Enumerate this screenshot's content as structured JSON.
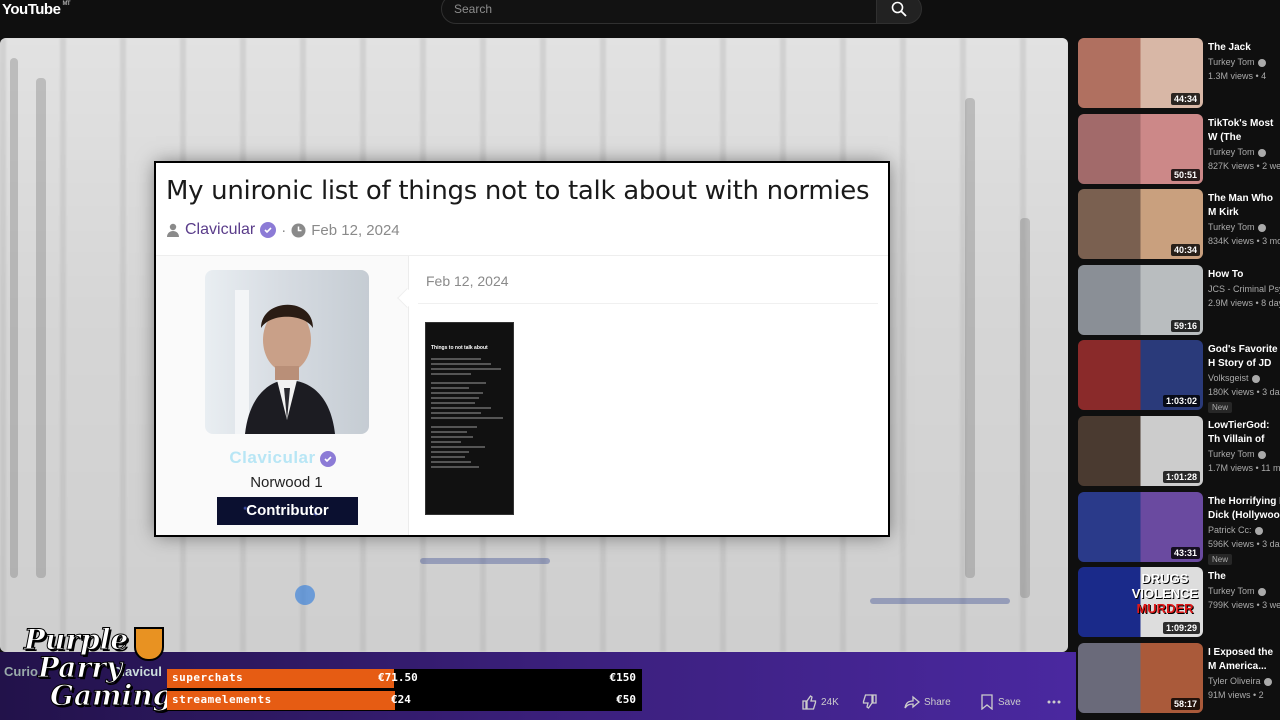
{
  "app": {
    "logo": "YouTube",
    "logo_sup": "MT",
    "search_placeholder": "Search"
  },
  "video_frame": {
    "title": "My unironic list of things not to talk about with normies",
    "author": "Clavicular",
    "date": "Feb 12, 2024",
    "post_date": "Feb 12, 2024",
    "profile": {
      "name": "Clavicular",
      "title": "Norwood 1",
      "badge": "Contributor"
    },
    "attachment_title": "Things to not talk about"
  },
  "overlay": {
    "logo_lines": [
      "Purple",
      "Parry",
      "Gaming"
    ],
    "channel_ghost": "Curio",
    "channel_ghost2": "Clavicul",
    "goals": [
      {
        "label": "superchats",
        "current": "€71.50",
        "goal": "€150",
        "fill": 0.477
      },
      {
        "label": "streamelements",
        "current": "€24",
        "goal": "€50",
        "fill": 0.48
      }
    ]
  },
  "actions": {
    "likes": "24K",
    "share": "Share",
    "save": "Save"
  },
  "sidebar": {
    "items": [
      {
        "title": "The Jack Doher",
        "channel": "Turkey Tom",
        "views": "1.3M views • 4",
        "duration": "44:34",
        "colors": [
          "#b07060",
          "#d8b7a6"
        ]
      },
      {
        "title": "TikTok's Most W (The Buddey)",
        "channel": "Turkey Tom",
        "views": "827K views • 2 we",
        "duration": "50:51",
        "colors": [
          "#a26a6a",
          "#c88"
        ]
      },
      {
        "title": "The Man Who M Kirk",
        "channel": "Turkey Tom",
        "views": "834K views • 3 mo",
        "duration": "40:34",
        "colors": [
          "#7a6050",
          "#c9a07e"
        ]
      },
      {
        "title": "How To Interrog",
        "channel": "JCS - Criminal Psy",
        "views": "2.9M views • 8 day",
        "duration": "59:16",
        "colors": [
          "#8a8f96",
          "#b9bdbf"
        ]
      },
      {
        "title": "God's Favorite H Story of JD Van",
        "channel": "Volksgeist",
        "views": "180K views • 3 day",
        "duration": "1:03:02",
        "new": "New",
        "colors": [
          "#8a2a2a",
          "#2a3a7a"
        ]
      },
      {
        "title": "LowTierGod: Th Villain of Comp",
        "channel": "Turkey Tom",
        "views": "1.7M views • 11 m",
        "duration": "1:01:28",
        "colors": [
          "#4a3a30",
          "#ccc"
        ]
      },
      {
        "title": "The Horrifying I Dick (Hollywoo",
        "channel": "Patrick Cc:",
        "views": "596K views • 3 day",
        "duration": "43:31",
        "new": "New",
        "colors": [
          "#2a3a8a",
          "#6a4aa0"
        ]
      },
      {
        "title": "The Bodybuilde",
        "channel": "Turkey Tom",
        "views": "799K views • 3 we",
        "duration": "1:09:29",
        "overlay": [
          "DRUGS",
          "VIOLENCE",
          "MURDER"
        ],
        "colors": [
          "#1a2a8a",
          "#ddd"
        ]
      },
      {
        "title": "I Exposed the M America...",
        "channel": "Tyler Oliveira",
        "views": "91M views • 2",
        "duration": "58:17",
        "colors": [
          "#6a6a7a",
          "#aa5a3a"
        ]
      }
    ]
  }
}
